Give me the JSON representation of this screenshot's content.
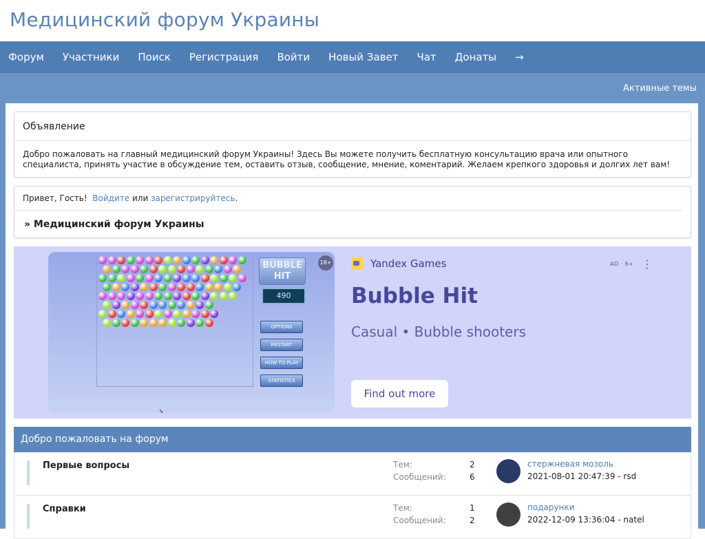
{
  "site": {
    "title": "Медицинский форум Украины"
  },
  "nav": {
    "items": [
      "Форум",
      "Участники",
      "Поиск",
      "Регистрация",
      "Войти",
      "Новый Завет",
      "Чат",
      "Донаты",
      "→"
    ]
  },
  "subnav": {
    "active_topics": "Активные темы"
  },
  "announcement": {
    "title": "Объявление",
    "text": "Добро пожаловать на главный медицинский форум Украины! Здесь Вы можете получить бесплатную консультацию врача или опытного специалиста, принять участие в обсуждение тем, оставить отзыв, сообщение, мнение, коментарий. Желаем крепкого здоровья и долгих лет вам!"
  },
  "greeting": {
    "hello": "Привет, Гость!",
    "login_link": "Войдите",
    "or": "или",
    "register_link": "зарегистрируйтесь",
    "dot": ".",
    "breadcrumb": "» Медицинский форум Украины"
  },
  "ad": {
    "brand": "Yandex Games",
    "label": "AD · 6+",
    "menu": "⋮",
    "title": "Bubble Hit",
    "subtitle": "Casual • Bubble shooters",
    "cta": "Find out more",
    "age_badge": "18+",
    "game_logo": "BUBBLE HIT",
    "score": "490",
    "buttons": [
      "OPTIONS",
      "RESTART",
      "HOW TO PLAY",
      "STATISTICS"
    ]
  },
  "forum": {
    "section_title": "Добро пожаловать на форум",
    "rows": [
      {
        "name": "Первые вопросы",
        "topics_label": "Тем:",
        "topics": "2",
        "posts_label": "Сообщений:",
        "posts": "6",
        "last_topic": "стержневая мозоль",
        "last_meta": "2021-08-01 20:47:39 - rsd"
      },
      {
        "name": "Справки",
        "topics_label": "Тем:",
        "topics": "1",
        "posts_label": "Сообщений:",
        "posts": "2",
        "last_topic": "подарунки",
        "last_meta": "2022-12-09 13:36:04 - natel"
      }
    ]
  }
}
